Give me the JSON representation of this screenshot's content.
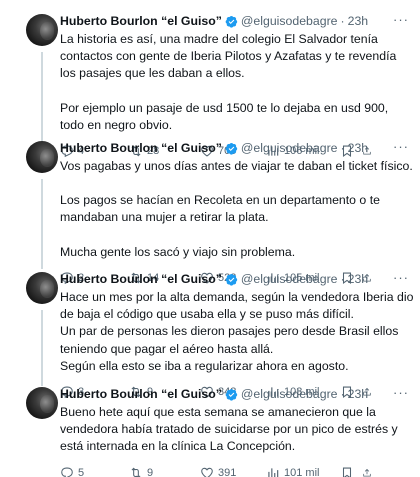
{
  "tweets": [
    {
      "author": "Huberto Bourlon “el Guiso”",
      "handle": "@elguisodebagre",
      "time": "23h",
      "paragraphs": [
        "La historia es así, una madre del colegio El Salvador tenía contactos con gente de Iberia Pilotos y Azafatas y te revendía los pasajes que les daban a ellos.",
        "Por ejemplo un pasaje de usd 1500 te lo dejaba en usd 900, todo en negro obvio."
      ],
      "replies": "4",
      "retweets": "28",
      "likes": "705",
      "views": "106 mil"
    },
    {
      "author": "Huberto Bourlon “el Guiso”",
      "handle": "@elguisodebagre",
      "time": "23h",
      "paragraphs": [
        "Vos pagabas y unos días antes de viajar te daban el ticket físico.",
        "Los pagos se hacían en Recoleta en un departamento o te mandaban una mujer a retirar la plata.",
        "Mucha gente los sacó y viajo sin problema."
      ],
      "replies": "2",
      "retweets": "14",
      "likes": "523",
      "views": "105 mil"
    },
    {
      "author": "Huberto Bourlon “el Guiso”",
      "handle": "@elguisodebagre",
      "time": "23h",
      "paragraphs": [
        "Hace un mes por la alta demanda, según la vendedora Iberia dio de baja el código que usaba ella y se puso más difícil.",
        "Un par de personas les dieron pasajes pero desde Brasil ellos teniendo que pagar el aéreo hasta allá.",
        "Según ella esto se iba a regularizar ahora en agosto."
      ],
      "replies": "3",
      "retweets": "9",
      "likes": "348",
      "views": "103 mil"
    },
    {
      "author": "Huberto Bourlon “el Guiso”",
      "handle": "@elguisodebagre",
      "time": "23h",
      "paragraphs": [
        "Bueno hete aquí que esta semana se amanecieron que la vendedora había tratado de suicidarse por un pico de estrés y está internada en la clínica La Concepción."
      ],
      "replies": "5",
      "retweets": "9",
      "likes": "391",
      "views": "101 mil"
    }
  ],
  "icons": {
    "verified_color": "#1d9bf0",
    "action_color": "#536471"
  }
}
